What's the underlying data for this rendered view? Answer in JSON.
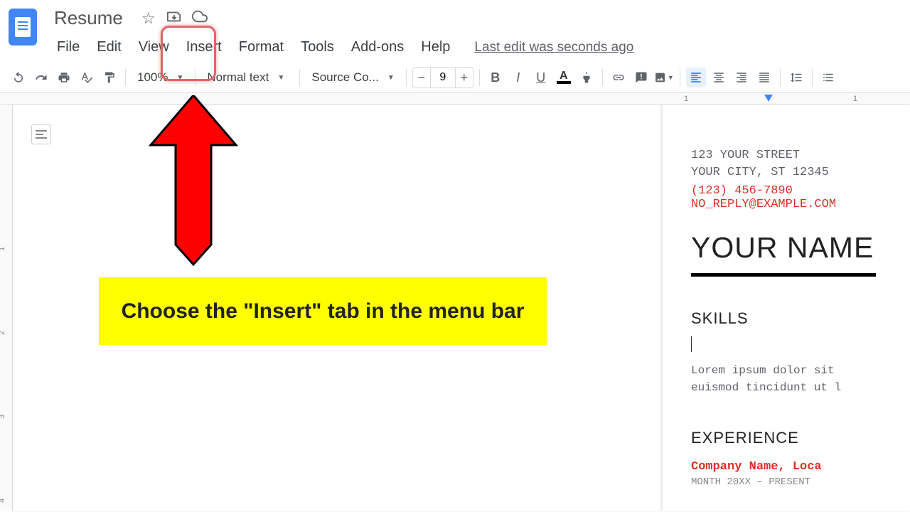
{
  "title": "Resume",
  "menu": {
    "file": "File",
    "edit": "Edit",
    "view": "View",
    "insert": "Insert",
    "format": "Format",
    "tools": "Tools",
    "addons": "Add-ons",
    "help": "Help",
    "lastEdit": "Last edit was seconds ago"
  },
  "toolbar": {
    "zoom": "100%",
    "style": "Normal text",
    "font": "Source Co...",
    "fontSize": "9"
  },
  "ruler": {
    "mark1": "1",
    "mark2": "1"
  },
  "vruler": {
    "m1": "1",
    "m2": "2",
    "m3": "3",
    "m4": "4"
  },
  "resume": {
    "addr1": "123 YOUR STREET",
    "addr2": "YOUR CITY, ST 12345",
    "phone": "(123) 456-7890",
    "email": "NO_REPLY@EXAMPLE.COM",
    "name": "YOUR NAME",
    "skills": "SKILLS",
    "lorem1": "Lorem ipsum dolor sit",
    "lorem2": "euismod tincidunt ut l",
    "experience": "EXPERIENCE",
    "company": "Company Name, Loca",
    "dates": "MONTH 20XX – PRESENT"
  },
  "callout": "Choose the \"Insert\" tab in the menu bar"
}
